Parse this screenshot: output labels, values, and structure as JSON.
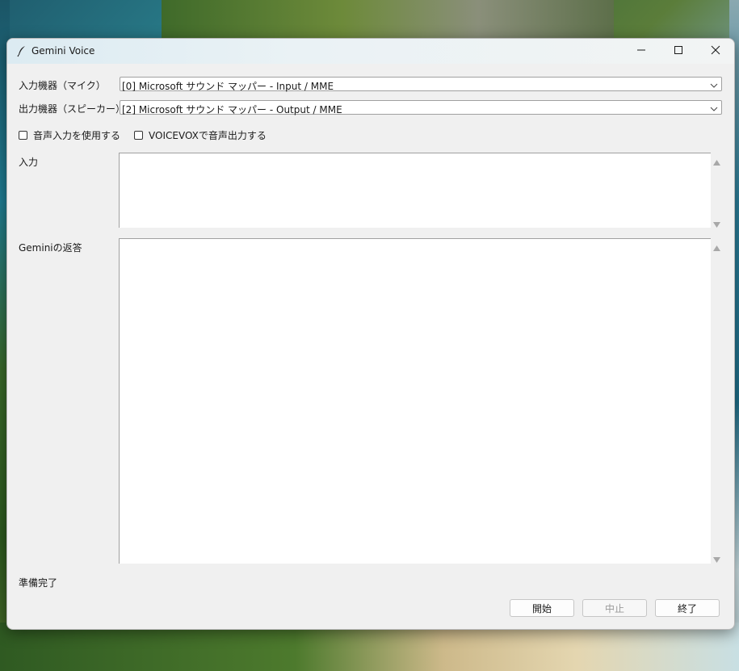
{
  "window": {
    "title": "Gemini Voice"
  },
  "window_controls": {
    "minimize_icon": "minimize-icon",
    "maximize_icon": "maximize-icon",
    "close_icon": "close-icon"
  },
  "devices": {
    "input_label": "入力機器（マイク）",
    "input_value": "[0] Microsoft サウンド マッパー - Input / MME",
    "output_label": "出力機器（スピーカー）",
    "output_value": "[2] Microsoft サウンド マッパー - Output / MME"
  },
  "options": {
    "use_voice_input_label": "音声入力を使用する",
    "use_voice_input_checked": false,
    "voicevox_output_label": "VOICEVOXで音声出力する",
    "voicevox_output_checked": false
  },
  "input_area": {
    "label": "入力",
    "value": ""
  },
  "response_area": {
    "label": "Geminiの返答",
    "value": ""
  },
  "status": {
    "text": "準備完了"
  },
  "buttons": {
    "start": "開始",
    "stop": "中止",
    "exit": "終了",
    "stop_enabled": false
  },
  "colors": {
    "window_bg": "#f0f0f0",
    "titlebar": "#e6f0f4",
    "field_bg": "#ffffff",
    "border": "#a0a0a0"
  }
}
